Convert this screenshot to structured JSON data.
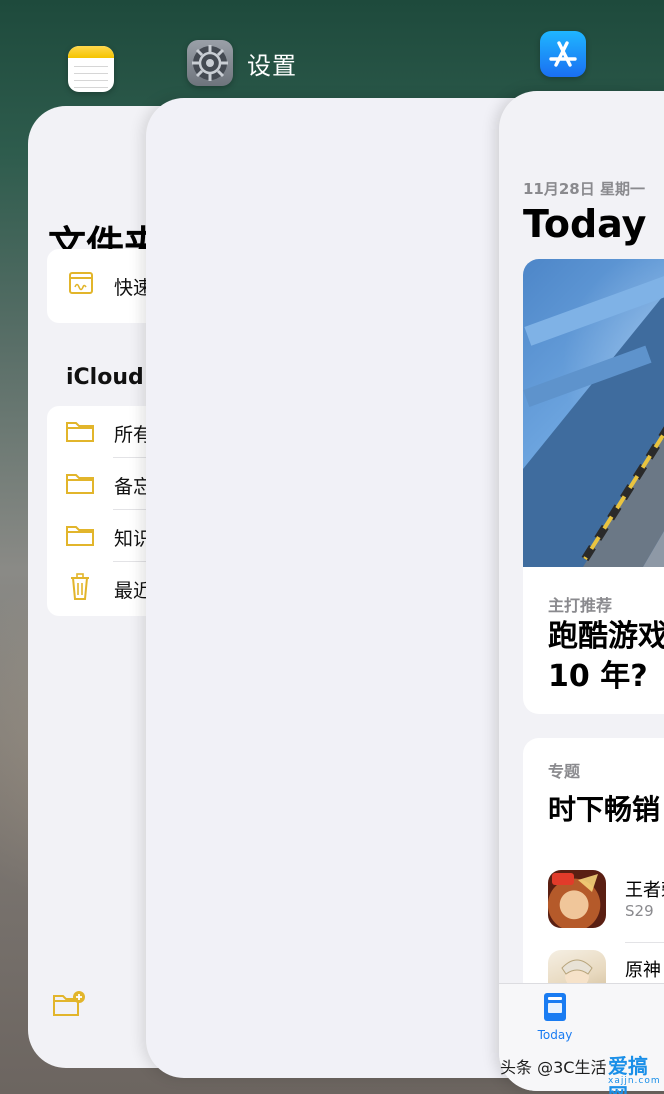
{
  "header": {
    "settings_title": "设置"
  },
  "notes_app": {
    "title": "文件夹",
    "quick_note": "快速备忘录",
    "section": "iCloud",
    "folders": [
      {
        "label": "所有 iCloud",
        "icon": "folder-icon"
      },
      {
        "label": "备忘录",
        "icon": "folder-icon"
      },
      {
        "label": "知识",
        "icon": "folder-icon"
      },
      {
        "label": "最近删除",
        "icon": "trash-icon"
      }
    ]
  },
  "app_store": {
    "date": "11月28日 星期一",
    "title": "Today",
    "feature": {
      "subtitle": "主打推荐",
      "title": "跑酷游戏\n10 年?"
    },
    "topic": {
      "subtitle": "专题",
      "title": "时下畅销"
    },
    "games": [
      {
        "name": "王者荣耀",
        "meta": "S29"
      },
      {
        "name": "原神",
        "meta": ""
      }
    ],
    "tab_today": "Today"
  },
  "watermark": {
    "text": "头条 @3C生活",
    "logo": "爱搞网",
    "site": "xajjn.com"
  },
  "colors": {
    "accent": "#1a7cf2",
    "notes_yellow": "#e2b52b"
  }
}
